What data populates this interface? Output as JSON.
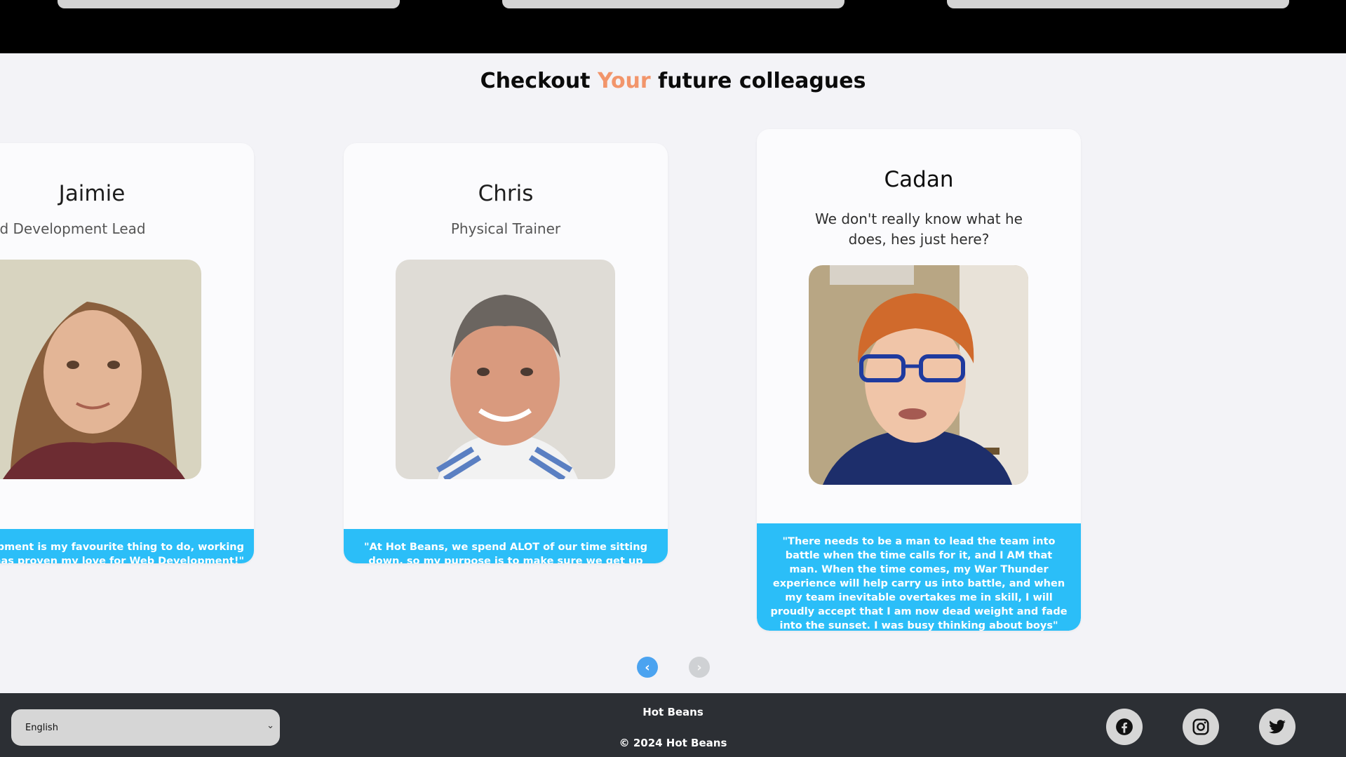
{
  "heading": {
    "before": "Checkout ",
    "accent": "Your",
    "after": " future colleagues"
  },
  "colors": {
    "accent": "#f2956b",
    "quote_bg": "#2bbef8",
    "nav_active": "#4ba3f0",
    "footer_bg": "#2c2f34"
  },
  "colleagues": [
    {
      "name": "Jaimie",
      "role": "ront-End Development Lead",
      "quote": "development is my favourite thing to do, working\nans has proven my love for Web Development!\""
    },
    {
      "name": "Chris",
      "role": "Physical Trainer",
      "quote": "\"At Hot Beans, we spend ALOT of our time sitting down, so my purpose is to make sure we get up and touch some grass every once in a while!\""
    },
    {
      "name": "Cadan",
      "role": "We don't really know what he does, hes just here?",
      "quote": "\"There needs to be a man to lead the team into battle when the time calls for it, and I AM that man. When the time comes, my War Thunder experience will help carry us into battle, and when my team inevitable overtakes me in skill, I will proudly accept that I am now dead weight and fade into the sunset. I was busy thinking about boys\""
    }
  ],
  "carousel_nav": {
    "prev_icon": "chevron-left-icon",
    "next_icon": "chevron-right-icon"
  },
  "footer": {
    "language": "English",
    "brand": "Hot Beans",
    "copyright": "© 2024 Hot Beans",
    "social": [
      "facebook-icon",
      "instagram-icon",
      "twitter-icon"
    ]
  }
}
